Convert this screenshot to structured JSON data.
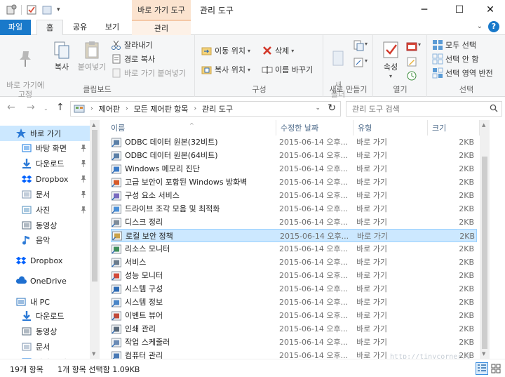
{
  "window": {
    "title": "관리 도구",
    "context_tab_header": "바로 가기 도구",
    "minimize": "─",
    "maximize": "☐",
    "close": "✕"
  },
  "tabs": [
    "파일",
    "홈",
    "공유",
    "보기",
    "관리"
  ],
  "ribbon": {
    "clipboard": {
      "label": "클립보드",
      "pin_quick": "바로 가기에\n고정",
      "copy": "복사",
      "paste": "붙여넣기",
      "cut": "잘라내기",
      "copy_path": "경로 복사",
      "paste_shortcut": "바로 가기 붙여넣기"
    },
    "organize": {
      "label": "구성",
      "move_to": "이동 위치",
      "copy_to": "복사 위치",
      "delete": "삭제",
      "rename": "이름 바꾸기"
    },
    "new": {
      "label": "새로 만들기",
      "new_folder": "새\n폴더"
    },
    "open": {
      "label": "열기",
      "properties": "속성"
    },
    "select": {
      "label": "선택",
      "select_all": "모두 선택",
      "select_none": "선택 안 함",
      "invert": "선택 영역 반전"
    }
  },
  "address": {
    "breadcrumbs": [
      "제어판",
      "모든 제어판 항목",
      "관리 도구"
    ],
    "search_placeholder": "관리 도구 검색"
  },
  "nav": [
    {
      "label": "바로 가기",
      "icon": "star-icon",
      "indent": 0,
      "selected": true
    },
    {
      "label": "바탕 화면",
      "icon": "desktop-icon",
      "indent": 1,
      "pinned": true
    },
    {
      "label": "다운로드",
      "icon": "download-icon",
      "indent": 1,
      "pinned": true
    },
    {
      "label": "Dropbox",
      "icon": "dropbox-icon",
      "indent": 1,
      "pinned": true
    },
    {
      "label": "문서",
      "icon": "document-icon",
      "indent": 1,
      "pinned": true
    },
    {
      "label": "사진",
      "icon": "pictures-icon",
      "indent": 1,
      "pinned": true
    },
    {
      "label": "동영상",
      "icon": "video-icon",
      "indent": 1
    },
    {
      "label": "음악",
      "icon": "music-icon",
      "indent": 1
    },
    {
      "label": "Dropbox",
      "icon": "dropbox-icon",
      "indent": 0
    },
    {
      "label": "OneDrive",
      "icon": "cloud-icon",
      "indent": 0
    },
    {
      "label": "내 PC",
      "icon": "computer-icon",
      "indent": 0
    },
    {
      "label": "다운로드",
      "icon": "download-icon",
      "indent": 1
    },
    {
      "label": "동영상",
      "icon": "video-icon",
      "indent": 1
    },
    {
      "label": "문서",
      "icon": "document-icon",
      "indent": 1
    },
    {
      "label": "바탕 화면",
      "icon": "desktop-icon",
      "indent": 1
    }
  ],
  "columns": [
    "이름",
    "수정한 날짜",
    "유형",
    "크기"
  ],
  "files": [
    {
      "name": "ODBC 데이터 원본(32비트)",
      "date": "2015-06-14 오후...",
      "type": "바로 가기",
      "size": "2KB",
      "icon": "odbc-icon"
    },
    {
      "name": "ODBC 데이터 원본(64비트)",
      "date": "2015-06-14 오후...",
      "type": "바로 가기",
      "size": "2KB",
      "icon": "odbc-icon"
    },
    {
      "name": "Windows 메모리 진단",
      "date": "2015-06-14 오후...",
      "type": "바로 가기",
      "size": "2KB",
      "icon": "memory-icon"
    },
    {
      "name": "고급 보안이 포함된 Windows 방화벽",
      "date": "2015-06-14 오후...",
      "type": "바로 가기",
      "size": "2KB",
      "icon": "firewall-icon"
    },
    {
      "name": "구성 요소 서비스",
      "date": "2015-06-14 오후...",
      "type": "바로 가기",
      "size": "2KB",
      "icon": "component-icon"
    },
    {
      "name": "드라이브 조각 모음 및 최적화",
      "date": "2015-06-14 오후...",
      "type": "바로 가기",
      "size": "2KB",
      "icon": "defrag-icon"
    },
    {
      "name": "디스크 정리",
      "date": "2015-06-14 오후...",
      "type": "바로 가기",
      "size": "2KB",
      "icon": "disk-cleanup-icon"
    },
    {
      "name": "로컬 보안 정책",
      "date": "2015-06-14 오후...",
      "type": "바로 가기",
      "size": "2KB",
      "icon": "security-policy-icon",
      "selected": true
    },
    {
      "name": "리소스 모니터",
      "date": "2015-06-14 오후...",
      "type": "바로 가기",
      "size": "2KB",
      "icon": "resource-monitor-icon"
    },
    {
      "name": "서비스",
      "date": "2015-06-14 오후...",
      "type": "바로 가기",
      "size": "2KB",
      "icon": "services-icon"
    },
    {
      "name": "성능 모니터",
      "date": "2015-06-14 오후...",
      "type": "바로 가기",
      "size": "2KB",
      "icon": "performance-icon"
    },
    {
      "name": "시스템 구성",
      "date": "2015-06-14 오후...",
      "type": "바로 가기",
      "size": "2KB",
      "icon": "system-config-icon"
    },
    {
      "name": "시스템 정보",
      "date": "2015-06-14 오후...",
      "type": "바로 가기",
      "size": "2KB",
      "icon": "system-info-icon"
    },
    {
      "name": "이벤트 뷰어",
      "date": "2015-06-14 오후...",
      "type": "바로 가기",
      "size": "2KB",
      "icon": "event-viewer-icon"
    },
    {
      "name": "인쇄 관리",
      "date": "2015-06-14 오후...",
      "type": "바로 가기",
      "size": "2KB",
      "icon": "print-icon"
    },
    {
      "name": "작업 스케줄러",
      "date": "2015-06-14 오후...",
      "type": "바로 가기",
      "size": "2KB",
      "icon": "scheduler-icon"
    },
    {
      "name": "컴퓨터 관리",
      "date": "2015-06-14 오후...",
      "type": "바로 가기",
      "size": "2KB",
      "icon": "computer-mgmt-icon"
    }
  ],
  "status": {
    "item_count": "19개 항목",
    "selection": "1개 항목 선택함 1.09KB"
  },
  "watermark": "http://tinycorner.t",
  "colors": {
    "accent": "#1979ca",
    "selection": "#cce8ff",
    "context_tab": "#fbe3cf"
  }
}
